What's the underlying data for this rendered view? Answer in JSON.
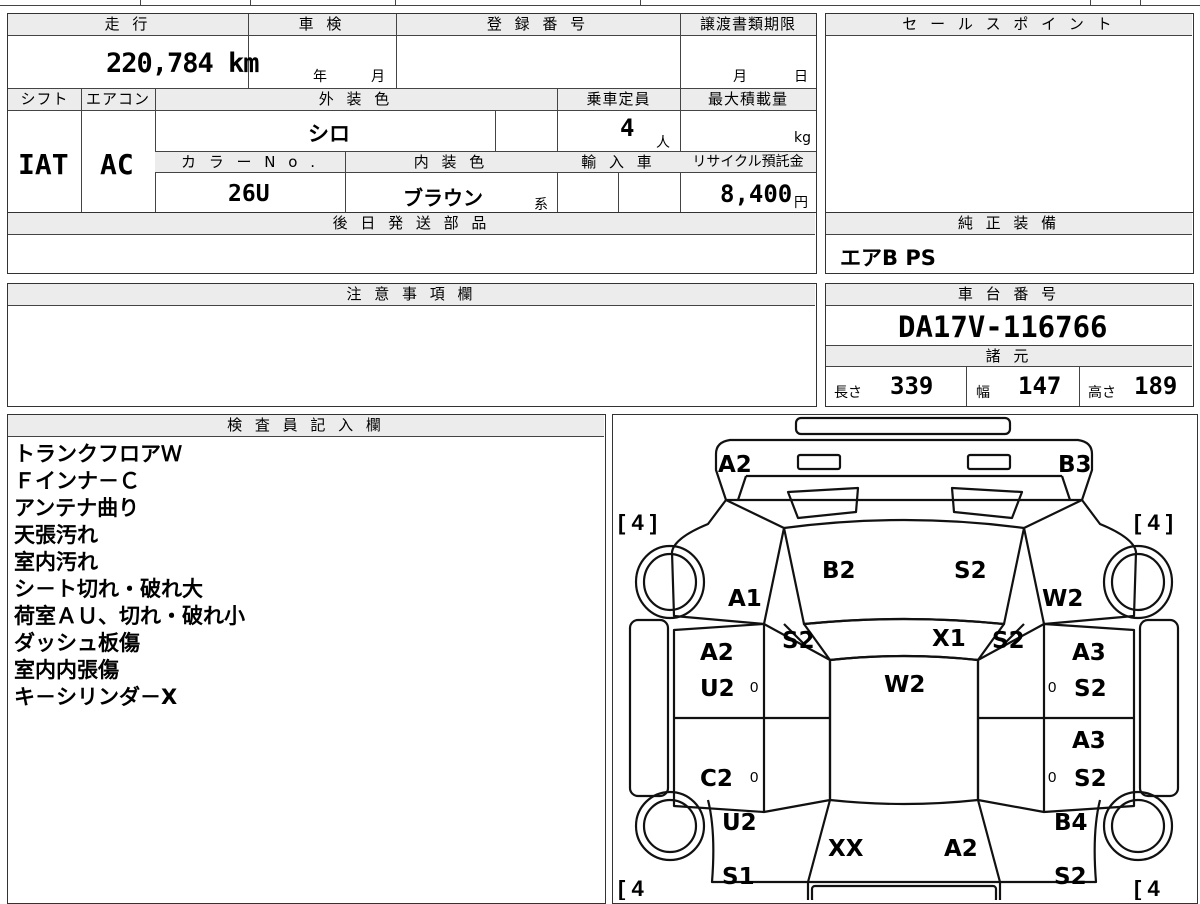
{
  "top": {
    "mileage_header": "走 行",
    "mileage_value": "220,784 km",
    "shaken_header": "車 検",
    "shaken_year": "年",
    "shaken_month": "月",
    "reg_header": "登 録 番 号",
    "transfer_header": "譲渡書類期限",
    "transfer_month": "月",
    "transfer_day": "日",
    "sales_header": "セ ー ル ス ポ イ ン ト"
  },
  "specs": {
    "shift_header": "シフト",
    "ac_header": "エアコン",
    "exterior_header": "外 装 色",
    "capacity_header": "乗車定員",
    "max_load_header": "最大積載量",
    "shift_value": "IAT",
    "ac_value": "AC",
    "exterior_value": "シロ",
    "capacity_value": "4",
    "capacity_unit": "人",
    "load_unit": "kg",
    "color_no_header": "カ ラ ー N o .",
    "interior_header": "内 装 色",
    "import_header": "輸 入 車",
    "recycle_header": "リサイクル預託金",
    "color_no_value": "26U",
    "interior_value": "ブラウン",
    "interior_suffix": "系",
    "recycle_value": "8,400",
    "recycle_unit": "円"
  },
  "later_parts_header": "後 日 発 送 部 品",
  "genuine_header": "純 正 装 備",
  "genuine_value": "エアB PS",
  "notes_header": "注 意 事 項 欄",
  "chassis": {
    "header": "車 台 番 号",
    "value": "DA17V-116766",
    "dims_header": "諸 元",
    "length_label": "長さ",
    "length_value": "339",
    "width_label": "幅",
    "width_value": "147",
    "height_label": "高さ",
    "height_value": "189"
  },
  "inspector": {
    "header": "検 査 員 記 入 欄",
    "lines": [
      "トランクフロアＷ",
      "Ｆインナ－Ｃ",
      "アンテナ曲り",
      "天張汚れ",
      "室内汚れ",
      "シ－ト切れ・破れ大",
      "荷室ＡＵ、切れ・破れ小",
      "ダッシュ板傷",
      "室内内張傷",
      "キ－シリンダ－X"
    ]
  },
  "diagram": {
    "tire_fl": "[ 4 ]",
    "tire_fr": "[ 4 ]",
    "tire_rl": "[ 4",
    "tire_rr": "[ 4",
    "marks": {
      "top_left": "A2",
      "top_right": "B3",
      "hood_left": "B2",
      "hood_right": "S2",
      "left_fender": "A1",
      "right_fender": "W2",
      "pillar_left": "S2",
      "windshield": "X1",
      "pillar_right": "S2",
      "left_front_door_1": "A2",
      "left_front_door_2": "U2",
      "roof": "W2",
      "right_front_door_1": "A3",
      "right_front_door_2": "S2",
      "right_rear_door_1": "A3",
      "left_rear_door": "C2",
      "right_rear_door_2": "S2",
      "left_quarter": "U2",
      "right_quarter": "B4",
      "rear_left": "XX",
      "rear_right": "A2",
      "bumper_left": "S1",
      "bumper_right": "S2"
    },
    "handle_marks": [
      "0",
      "0",
      "0",
      "0"
    ]
  }
}
